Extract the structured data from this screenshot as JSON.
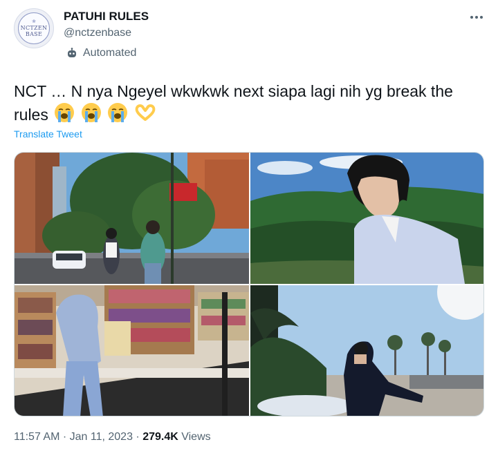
{
  "tweet": {
    "author": {
      "display_name": "PATUHI RULES",
      "handle": "@nctzenbase",
      "avatar_text_line1": "NCTZEN",
      "avatar_text_line2": "BASE",
      "automated_label": "Automated"
    },
    "text": "NCT … N nya Ngeyel wkwkwk next siapa lagi nih yg break the rules",
    "emojis": [
      "loudly-crying-face",
      "loudly-crying-face",
      "loudly-crying-face",
      "heart-hands"
    ],
    "translate_label": "Translate Tweet",
    "media": [
      {
        "description": "two-people-city-street-photo"
      },
      {
        "description": "man-mountain-view-photo"
      },
      {
        "description": "person-store-shelves-photo"
      },
      {
        "description": "man-garden-sunny-photo"
      }
    ],
    "time": "11:57 AM",
    "separator": " · ",
    "date": "Jan 11, 2023",
    "views_count": "279.4K",
    "views_label": " Views"
  },
  "colors": {
    "text_primary": "#0f1419",
    "text_secondary": "#536471",
    "link": "#1d9bf0",
    "border": "#cfd9de"
  }
}
